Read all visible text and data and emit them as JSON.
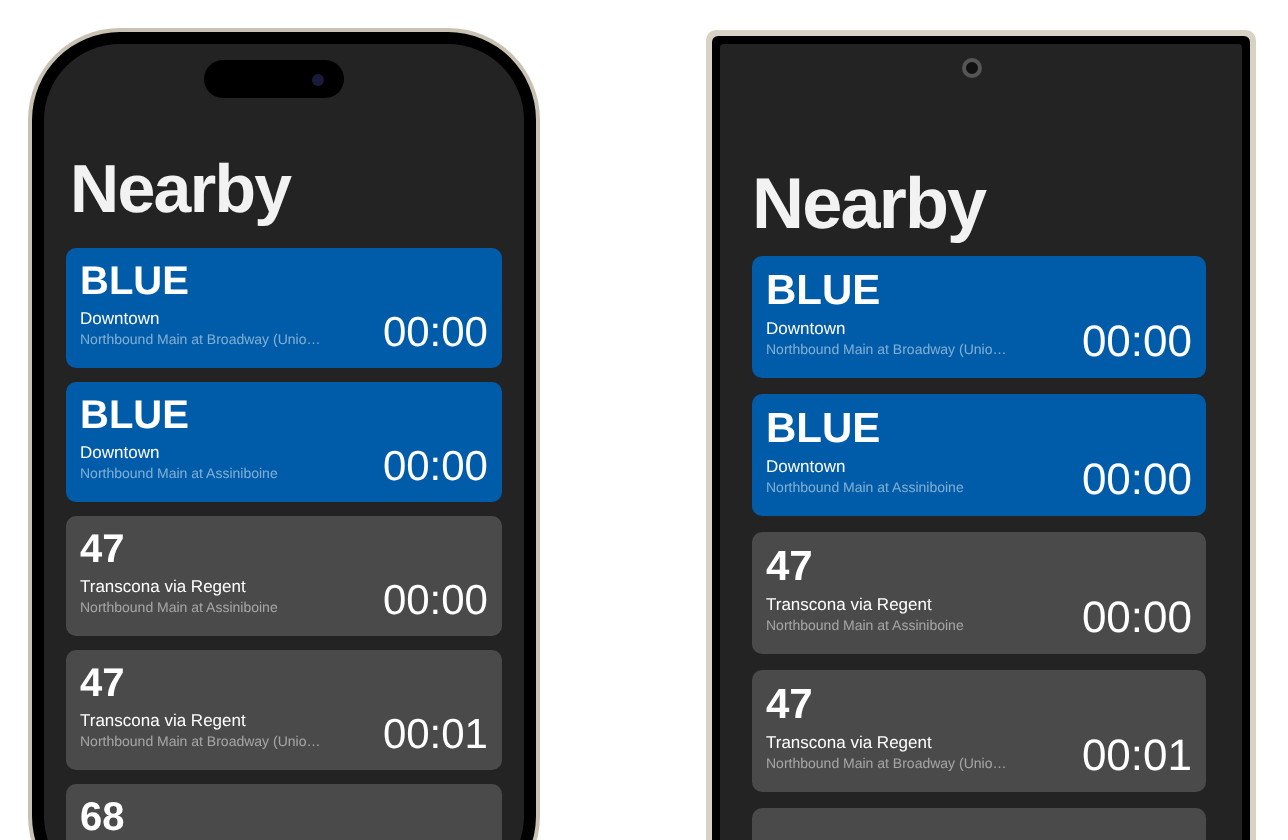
{
  "phones": [
    {
      "kind": "iphone",
      "title": "Nearby",
      "cards": [
        {
          "route": "BLUE",
          "destination": "Downtown",
          "stop": "Northbound Main at Broadway (Unio…",
          "time": "00:00",
          "color": "#005ca8"
        },
        {
          "route": "BLUE",
          "destination": "Downtown",
          "stop": "Northbound Main at Assiniboine",
          "time": "00:00",
          "color": "#005ca8"
        },
        {
          "route": "47",
          "destination": "Transcona via Regent",
          "stop": "Northbound Main at Assiniboine",
          "time": "00:00",
          "color": "#4a4a4a"
        },
        {
          "route": "47",
          "destination": "Transcona via Regent",
          "stop": "Northbound Main at Broadway (Unio…",
          "time": "00:01",
          "color": "#4a4a4a"
        },
        {
          "route": "68",
          "color": "#4a4a4a"
        }
      ]
    },
    {
      "kind": "android",
      "title": "Nearby",
      "cards": [
        {
          "route": "BLUE",
          "destination": "Downtown",
          "stop": "Northbound Main at Broadway (Unio…",
          "time": "00:00",
          "color": "#005ca8"
        },
        {
          "route": "BLUE",
          "destination": "Downtown",
          "stop": "Northbound Main at Assiniboine",
          "time": "00:00",
          "color": "#005ca8"
        },
        {
          "route": "47",
          "destination": "Transcona via Regent",
          "stop": "Northbound Main at Assiniboine",
          "time": "00:00",
          "color": "#4a4a4a"
        },
        {
          "route": "47",
          "destination": "Transcona via Regent",
          "stop": "Northbound Main at Broadway (Unio…",
          "time": "00:01",
          "color": "#4a4a4a"
        },
        {
          "color": "#4a4a4a"
        }
      ]
    }
  ]
}
